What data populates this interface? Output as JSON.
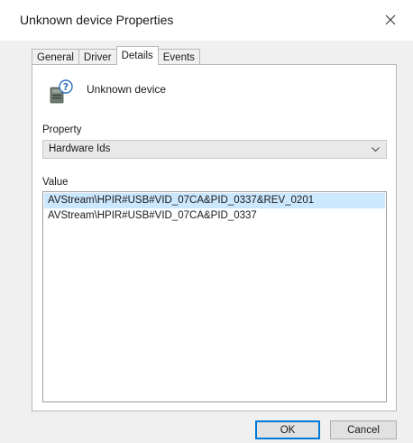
{
  "window": {
    "title": "Unknown device Properties",
    "close_icon": "close-icon"
  },
  "tabs": [
    {
      "label": "General",
      "active": false
    },
    {
      "label": "Driver",
      "active": false
    },
    {
      "label": "Details",
      "active": true
    },
    {
      "label": "Events",
      "active": false
    }
  ],
  "device": {
    "icon": "unknown-device-icon",
    "name": "Unknown device"
  },
  "property": {
    "label": "Property",
    "selected": "Hardware Ids"
  },
  "value": {
    "label": "Value",
    "items": [
      {
        "text": "AVStream\\HPIR#USB#VID_07CA&PID_0337&REV_0201",
        "selected": true
      },
      {
        "text": "AVStream\\HPIR#USB#VID_07CA&PID_0337",
        "selected": false
      }
    ]
  },
  "buttons": {
    "ok": "OK",
    "cancel": "Cancel"
  },
  "colors": {
    "selection": "#cce8ff",
    "accent": "#0078d7"
  }
}
